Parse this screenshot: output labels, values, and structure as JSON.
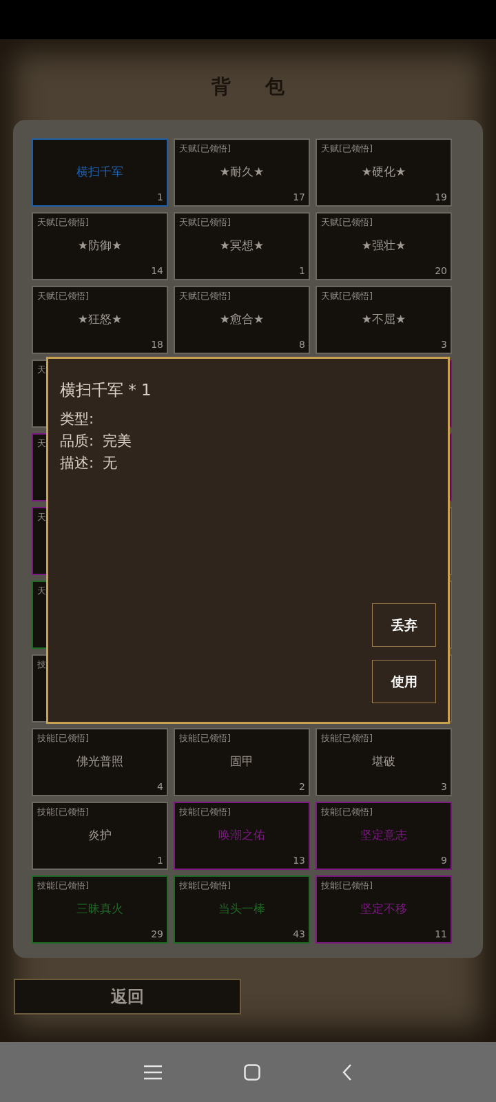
{
  "title": "背 包",
  "grid": [
    [
      {
        "kind": "item",
        "name": "横扫千军",
        "count": "1",
        "color": "#1f5fa8"
      },
      {
        "kind": "item",
        "label": "天赋[已领悟]",
        "name": "★耐久★",
        "count": "17",
        "color": "#6b6660"
      },
      {
        "kind": "item",
        "label": "天赋[已领悟]",
        "name": "★硬化★",
        "count": "19",
        "color": "#6b6660"
      }
    ],
    [
      {
        "kind": "item",
        "label": "天赋[已领悟]",
        "name": "★防御★",
        "count": "14",
        "color": "#6b6660"
      },
      {
        "kind": "item",
        "label": "天赋[已领悟]",
        "name": "★冥想★",
        "count": "1",
        "color": "#6b6660"
      },
      {
        "kind": "item",
        "label": "天赋[已领悟]",
        "name": "★强壮★",
        "count": "20",
        "color": "#6b6660"
      }
    ],
    [
      {
        "kind": "item",
        "label": "天赋[已领悟]",
        "name": "★狂怒★",
        "count": "18",
        "color": "#6b6660"
      },
      {
        "kind": "item",
        "label": "天赋[已领悟]",
        "name": "★愈合★",
        "count": "8",
        "color": "#6b6660"
      },
      {
        "kind": "item",
        "label": "天赋[已领悟]",
        "name": "★不屈★",
        "count": "3",
        "color": "#6b6660"
      }
    ],
    [
      {
        "kind": "item",
        "label": "天",
        "color": "#6b6660"
      },
      {
        "kind": "hidden"
      },
      {
        "kind": "item",
        "color": "#7a1a80"
      }
    ],
    [
      {
        "kind": "item",
        "label": "天",
        "color": "#7a1a80"
      },
      {
        "kind": "hidden"
      },
      {
        "kind": "item",
        "color": "#7a1a80"
      }
    ],
    [
      {
        "kind": "item",
        "label": "天",
        "color": "#7a1a80"
      },
      {
        "kind": "hidden"
      },
      {
        "kind": "item",
        "color": "#6b6660"
      }
    ],
    [
      {
        "kind": "item",
        "label": "天",
        "color": "#1f6a25"
      },
      {
        "kind": "hidden"
      },
      {
        "kind": "item",
        "color": "#6b6660"
      }
    ],
    [
      {
        "kind": "item",
        "label": "技",
        "color": "#6b6660"
      },
      {
        "kind": "hidden"
      },
      {
        "kind": "item",
        "color": "#6b6660"
      }
    ],
    [
      {
        "kind": "item",
        "label": "技能[已领悟]",
        "name": "佛光普照",
        "count": "4",
        "color": "#6b6660"
      },
      {
        "kind": "item",
        "label": "技能[已领悟]",
        "name": "固甲",
        "count": "2",
        "color": "#6b6660"
      },
      {
        "kind": "item",
        "label": "技能[已领悟]",
        "name": "堪破",
        "count": "3",
        "color": "#6b6660"
      }
    ],
    [
      {
        "kind": "item",
        "label": "技能[已领悟]",
        "name": "炎护",
        "count": "1",
        "color": "#6b6660"
      },
      {
        "kind": "item",
        "label": "技能[已领悟]",
        "name": "唤潮之佑",
        "count": "13",
        "color": "#7a1a80"
      },
      {
        "kind": "item",
        "label": "技能[已领悟]",
        "name": "坚定意志",
        "count": "9",
        "color": "#7a1a80"
      }
    ],
    [
      {
        "kind": "item",
        "label": "技能[已领悟]",
        "name": "三昧真火",
        "count": "29",
        "color": "#1f6a25"
      },
      {
        "kind": "item",
        "label": "技能[已领悟]",
        "name": "当头一棒",
        "count": "43",
        "color": "#1f6a25"
      },
      {
        "kind": "item",
        "label": "技能[已领悟]",
        "name": "坚定不移",
        "count": "11",
        "color": "#7a1a80"
      }
    ]
  ],
  "popup": {
    "title": "横扫千军 * 1",
    "lines": [
      "类型:",
      "品质:  完美",
      "描述:  无"
    ],
    "buttons": [
      "丢弃",
      "使用"
    ]
  },
  "back_button": "返回"
}
